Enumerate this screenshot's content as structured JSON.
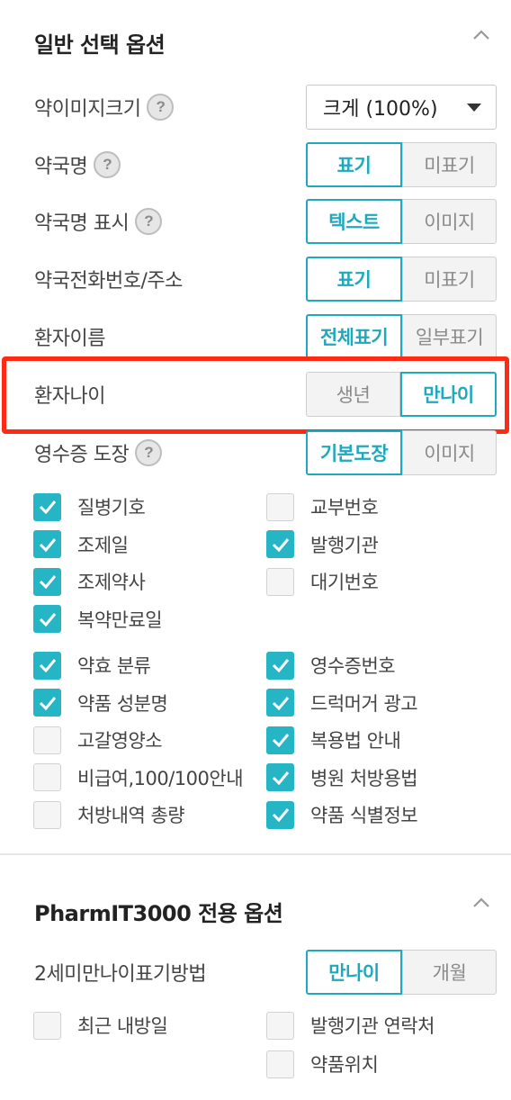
{
  "general": {
    "title": "일반 선택 옵션",
    "options": {
      "image_size": {
        "label": "약이미지크기",
        "value": "크게 (100%)"
      },
      "pharmacy_name": {
        "label": "약국명",
        "on": "표기",
        "off": "미표기"
      },
      "pharmacy_display": {
        "label": "약국명 표시",
        "on": "텍스트",
        "off": "이미지"
      },
      "pharmacy_contact": {
        "label": "약국전화번호/주소",
        "on": "표기",
        "off": "미표기"
      },
      "patient_name": {
        "label": "환자이름",
        "on": "전체표기",
        "off": "일부표기"
      },
      "patient_age": {
        "label": "환자나이",
        "left": "생년",
        "right": "만나이"
      },
      "receipt_stamp": {
        "label": "영수증 도장",
        "on": "기본도장",
        "off": "이미지"
      }
    },
    "help_icon": "?",
    "group1": {
      "left": [
        {
          "label": "질병기호",
          "checked": true
        },
        {
          "label": "조제일",
          "checked": true
        },
        {
          "label": "조제약사",
          "checked": true
        },
        {
          "label": "복약만료일",
          "checked": true
        }
      ],
      "right": [
        {
          "label": "교부번호",
          "checked": false
        },
        {
          "label": "발행기관",
          "checked": true
        },
        {
          "label": "대기번호",
          "checked": false
        }
      ]
    },
    "group2": {
      "left": [
        {
          "label": "약효 분류",
          "checked": true
        },
        {
          "label": "약품 성분명",
          "checked": true
        },
        {
          "label": "고갈영양소",
          "checked": false
        },
        {
          "label": "비급여,100/100안내",
          "checked": false
        },
        {
          "label": "처방내역 총량",
          "checked": false
        }
      ],
      "right": [
        {
          "label": "영수증번호",
          "checked": true
        },
        {
          "label": "드럭머거 광고",
          "checked": true
        },
        {
          "label": "복용법 안내",
          "checked": true
        },
        {
          "label": "병원 처방용법",
          "checked": true
        },
        {
          "label": "약품 식별정보",
          "checked": true
        }
      ]
    }
  },
  "pharmit": {
    "title": "PharmIT3000 전용 옵션",
    "age_method": {
      "label": "2세미만나이표기방법",
      "on": "만나이",
      "off": "개월"
    },
    "checks": {
      "left": [
        {
          "label": "최근 내방일",
          "checked": false
        }
      ],
      "right": [
        {
          "label": "발행기관 연락처",
          "checked": false
        },
        {
          "label": "약품위치",
          "checked": false
        }
      ]
    }
  },
  "colors": {
    "accent": "#1fa9bc",
    "check": "#26b5c4",
    "highlight": "#ff2a14"
  }
}
